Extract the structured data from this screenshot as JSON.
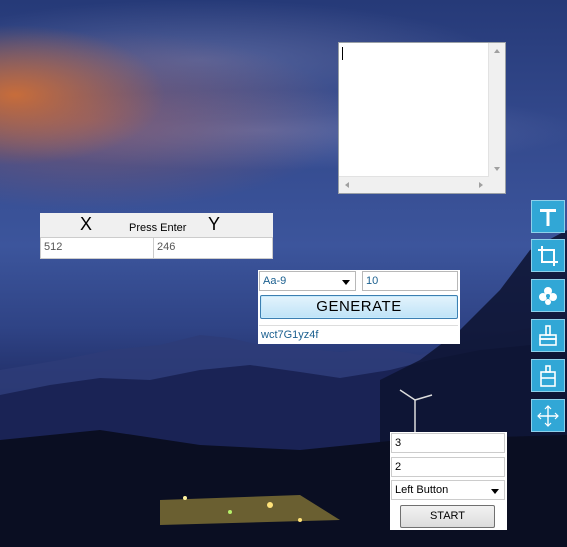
{
  "memo": {
    "text": ""
  },
  "coords": {
    "x_label": "X",
    "hint": "Press Enter",
    "y_label": "Y",
    "x_value": "512",
    "y_value": "246"
  },
  "generator": {
    "charset": "Aa-9",
    "length": "10",
    "button": "GENERATE",
    "output": "wct7G1yz4f"
  },
  "tools": [
    {
      "name": "text-tool",
      "icon": "text-T-icon"
    },
    {
      "name": "crop-tool",
      "icon": "crop-icon"
    },
    {
      "name": "color-picker-tool",
      "icon": "pinwheel-icon"
    },
    {
      "name": "brush-tool",
      "icon": "brush-icon"
    },
    {
      "name": "clipboard-tool",
      "icon": "clipboard-icon"
    },
    {
      "name": "crosshair-tool",
      "icon": "crosshair-icon"
    }
  ],
  "colors": {
    "tool_bg": "#31a7d6",
    "link_text": "#1a5f8f",
    "button_border": "#3c7fb1"
  },
  "clicker": {
    "count": "3",
    "interval": "2",
    "button_type": "Left Button",
    "start_label": "START"
  }
}
